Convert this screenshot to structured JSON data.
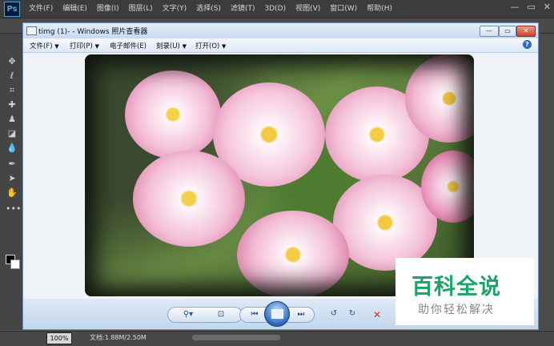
{
  "photoshop": {
    "logo": "Ps",
    "menu": [
      "文件(F)",
      "编辑(E)",
      "图像(I)",
      "图层(L)",
      "文字(Y)",
      "选择(S)",
      "滤镜(T)",
      "3D(D)",
      "视图(V)",
      "窗口(W)",
      "帮助(H)"
    ],
    "window_controls": {
      "minimize": "—",
      "restore": "▭",
      "close": "✕"
    },
    "tools": [
      "move-icon",
      "lasso-icon",
      "crop-icon",
      "healing-icon",
      "stamp-icon",
      "eraser-icon",
      "blur-icon",
      "pen-icon",
      "path-select-icon",
      "hand-icon",
      "more-icon"
    ],
    "status": {
      "zoom": "100%",
      "doc_info": "文档:1.88M/2.50M"
    }
  },
  "photo_viewer": {
    "title": "timg (1)- - Windows 照片查看器",
    "window_controls": {
      "minimize": "—",
      "maximize": "▭",
      "close": "✕"
    },
    "menu": [
      {
        "label": "文件(F)",
        "arrow": "▼"
      },
      {
        "label": "打印(P)",
        "arrow": "▼"
      },
      {
        "label": "电子邮件(E)",
        "arrow": ""
      },
      {
        "label": "刻录(U)",
        "arrow": "▼"
      },
      {
        "label": "打开(O)",
        "arrow": "▼"
      }
    ],
    "help": "?",
    "toolbar": {
      "zoom": "⚲▾",
      "fit": "⊡",
      "previous": "⏮",
      "slideshow": "slideshow-icon",
      "next": "⏭",
      "rotate_left": "↺",
      "rotate_right": "↻",
      "delete": "✕"
    }
  },
  "watermark": {
    "main": "百科全说",
    "sub": "助你轻松解决"
  }
}
